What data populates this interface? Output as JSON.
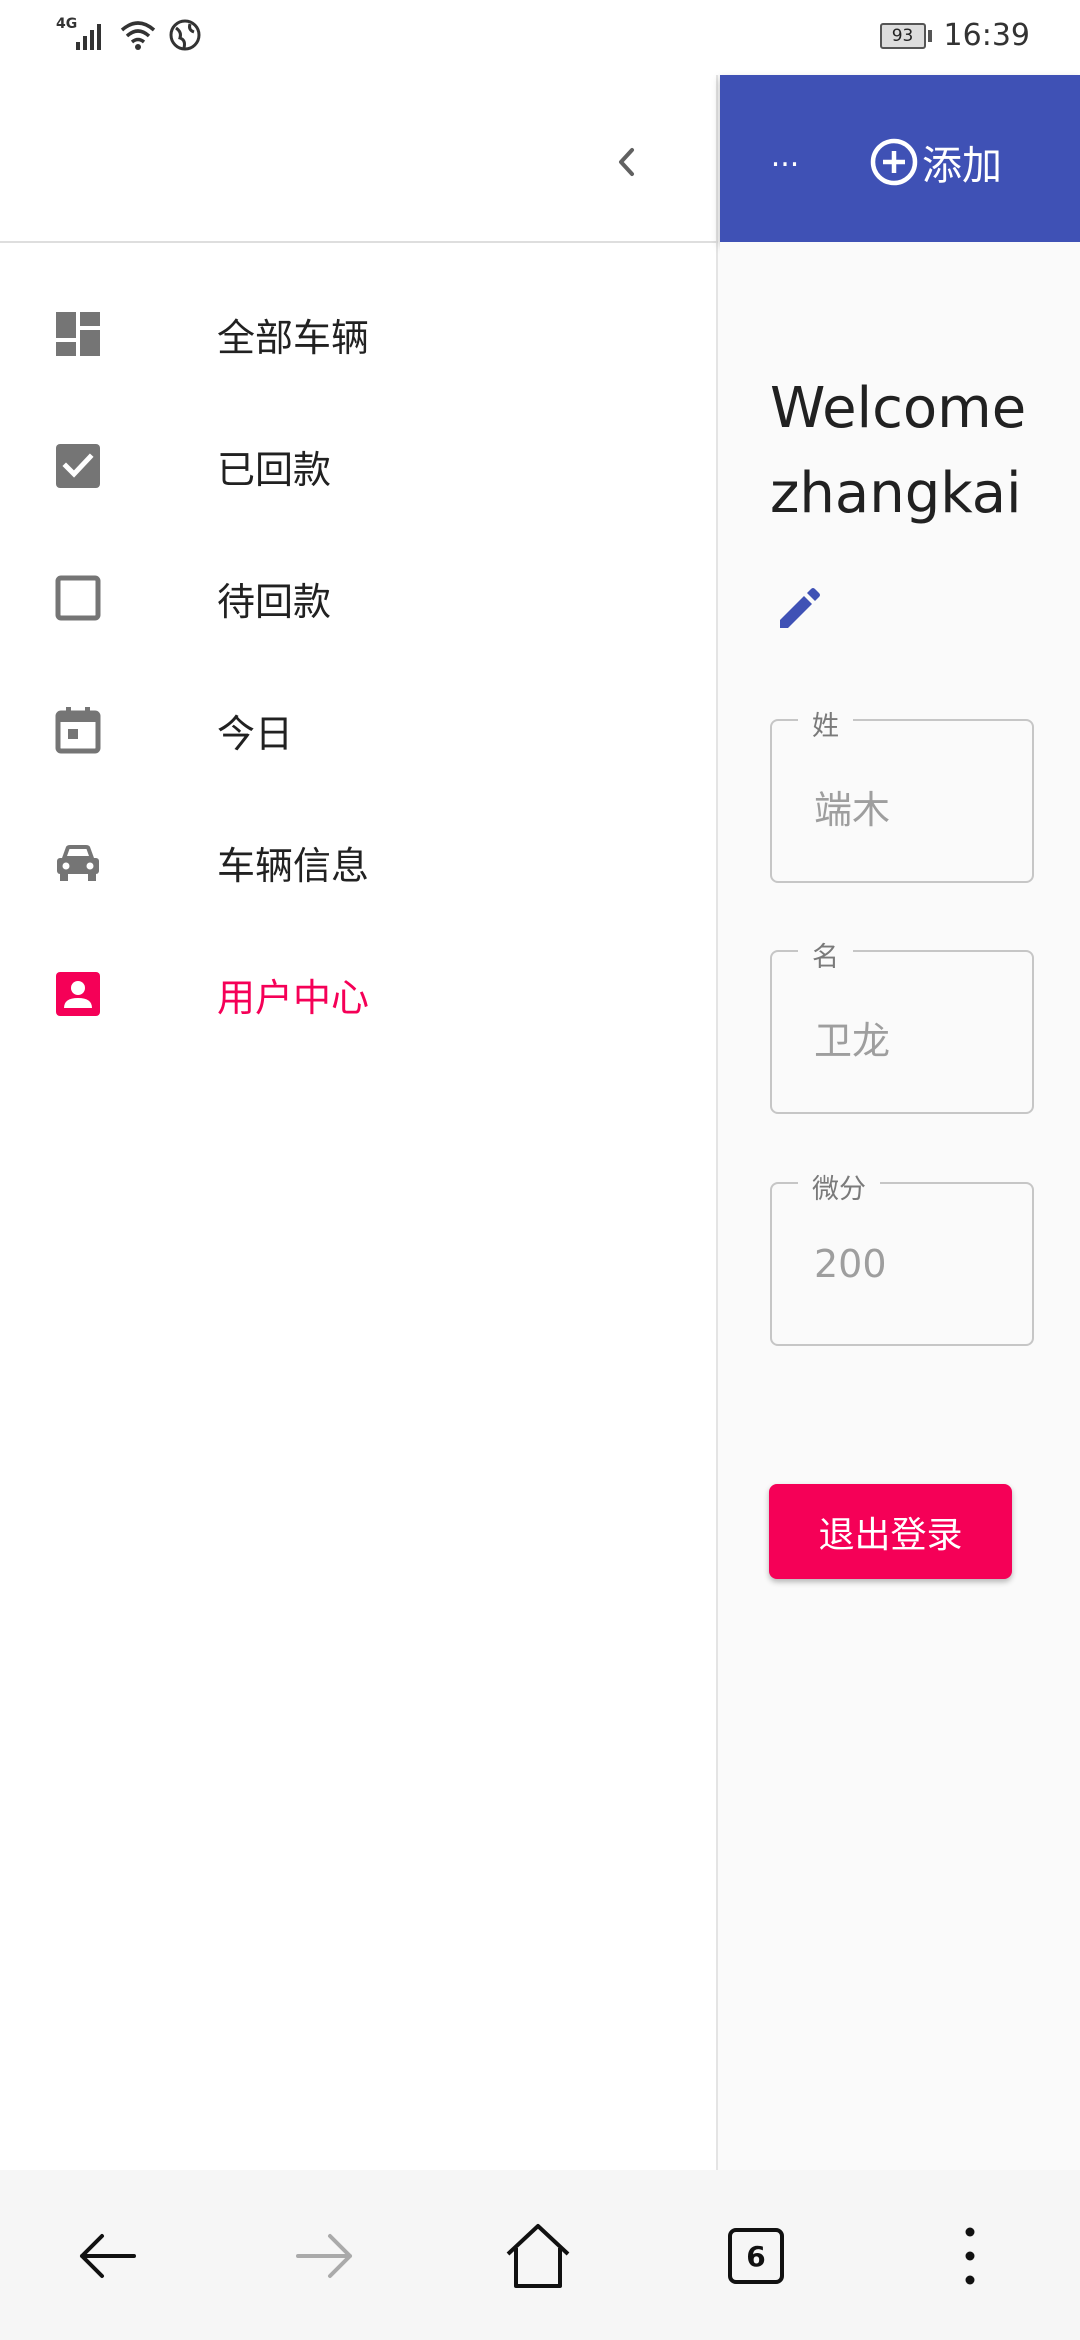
{
  "status_bar": {
    "network": "4G",
    "battery": "93",
    "time": "16:39"
  },
  "drawer": {
    "items": [
      {
        "label": "全部车辆",
        "icon": "dashboard-icon",
        "active": false
      },
      {
        "label": "已回款",
        "icon": "checkbox-checked-icon",
        "active": false
      },
      {
        "label": "待回款",
        "icon": "checkbox-empty-icon",
        "active": false
      },
      {
        "label": "今日",
        "icon": "calendar-icon",
        "active": false
      },
      {
        "label": "车辆信息",
        "icon": "car-icon",
        "active": false
      },
      {
        "label": "用户中心",
        "icon": "account-box-icon",
        "active": true
      }
    ]
  },
  "app_bar": {
    "more_label": "...",
    "add_label": "添加"
  },
  "main": {
    "welcome_line1": "Welcome",
    "welcome_line2": "zhangkai",
    "fields": [
      {
        "label": "姓",
        "value": "端木"
      },
      {
        "label": "名",
        "value": "卫龙"
      },
      {
        "label": "微分",
        "value": "200"
      }
    ],
    "logout_label": "退出登录"
  },
  "bottom_bar": {
    "tab_count": "6"
  },
  "colors": {
    "primary": "#3f51b5",
    "accent": "#f50057",
    "icon_gray": "#757575"
  }
}
